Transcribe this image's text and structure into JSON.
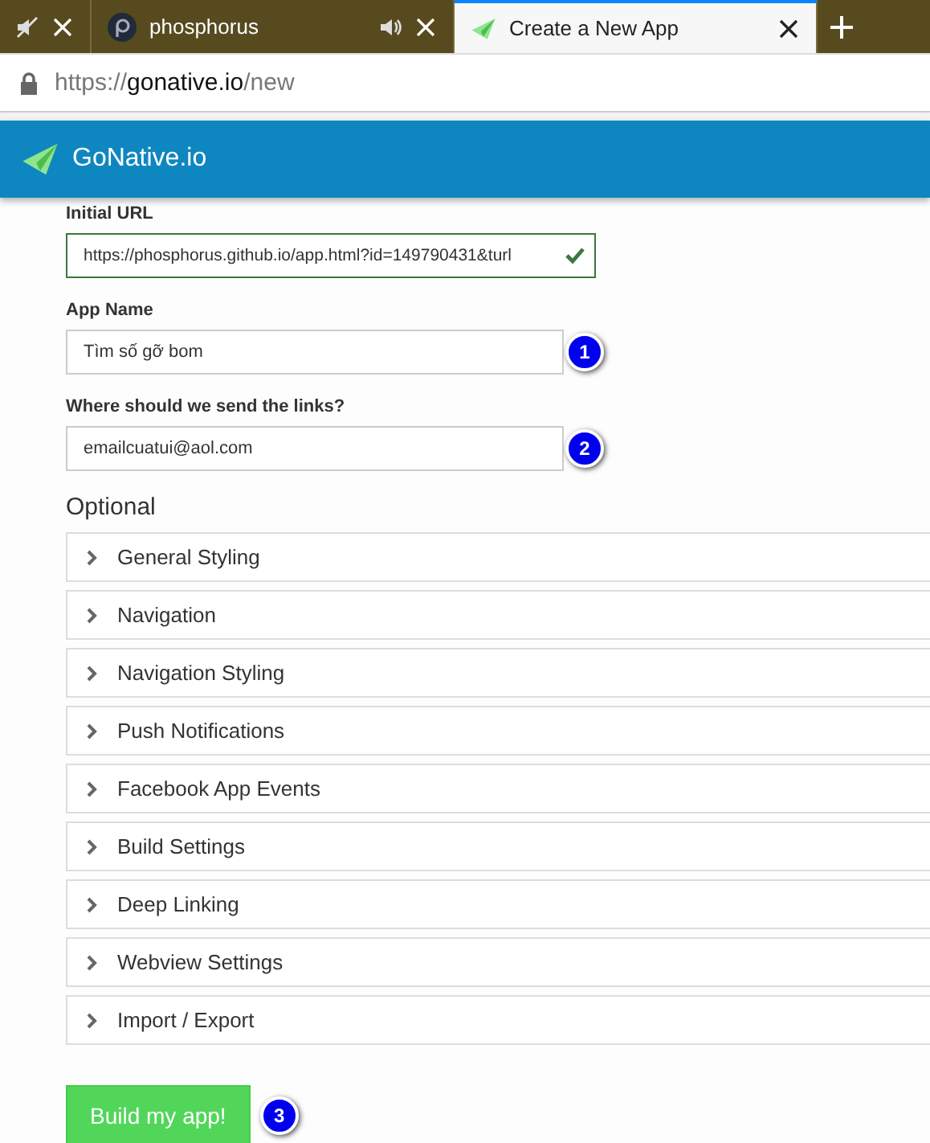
{
  "browser": {
    "tabs": [
      {
        "muted": true,
        "selected": false
      },
      {
        "title": "phosphorus",
        "muted": false,
        "selected": false
      },
      {
        "title": "Create a New App",
        "selected": true
      }
    ],
    "address": {
      "scheme": "https://",
      "host": "gonative.io",
      "path": "/new"
    }
  },
  "header": {
    "brand": "GoNative.io"
  },
  "form": {
    "fields": [
      {
        "label": "Initial URL",
        "value": "https://phosphorus.github.io/app.html?id=149790431&turl",
        "valid": true
      },
      {
        "label": "App Name",
        "value": "Tìm số gỡ bom",
        "marker": "1"
      },
      {
        "label": "Where should we send the links?",
        "value": "emailcuatui@aol.com",
        "marker": "2"
      }
    ],
    "optional_heading": "Optional",
    "sections": [
      {
        "title": "General Styling",
        "expanded": false
      },
      {
        "title": "Navigation",
        "expanded": false
      },
      {
        "title": "Navigation Styling",
        "expanded": false
      },
      {
        "title": "Push Notifications",
        "expanded": false
      },
      {
        "title": "Facebook App Events",
        "expanded": false
      },
      {
        "title": "Build Settings",
        "expanded": false
      },
      {
        "title": "Deep Linking",
        "expanded": false
      },
      {
        "title": "Webview Settings",
        "expanded": false
      },
      {
        "title": "Import / Export",
        "expanded": false
      }
    ],
    "submit": {
      "label": "Build my app!",
      "marker": "3"
    }
  }
}
